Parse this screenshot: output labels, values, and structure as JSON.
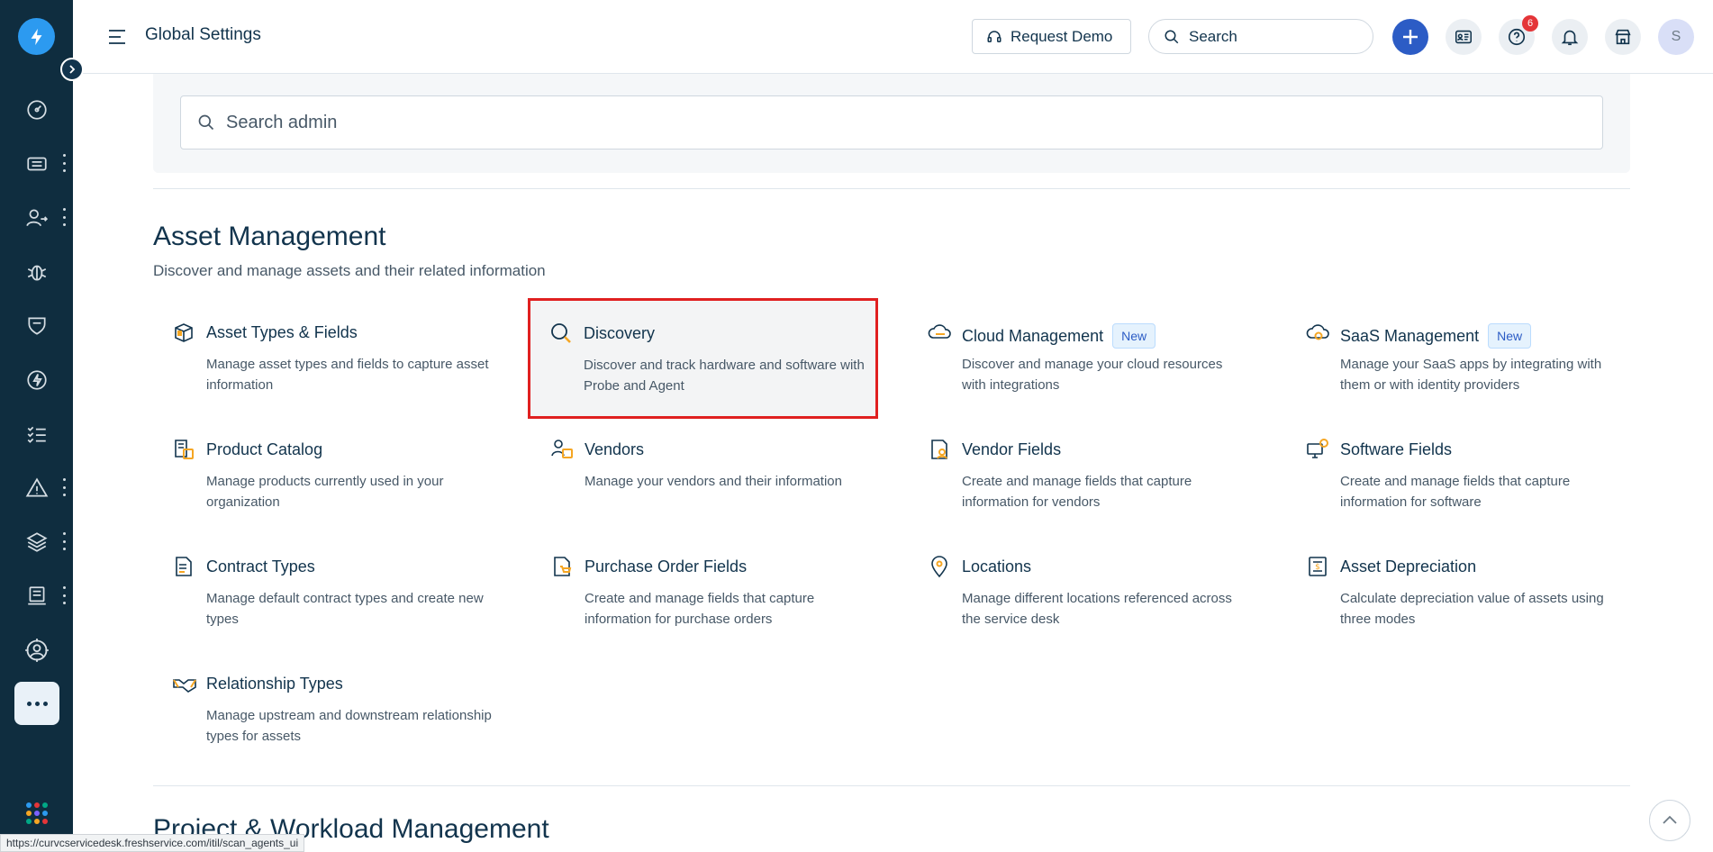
{
  "header": {
    "page_title": "Global Settings",
    "request_demo_label": "Request Demo",
    "search_placeholder": "Search",
    "help_badge_count": "6",
    "avatar_initial": "S"
  },
  "admin_search": {
    "placeholder": "Search admin"
  },
  "section": {
    "title": "Asset Management",
    "description": "Discover and manage assets and their related information"
  },
  "cards": [
    {
      "title": "Asset Types & Fields",
      "description": "Manage asset types and fields to capture asset information",
      "icon": "asset-types-icon"
    },
    {
      "title": "Discovery",
      "description": "Discover and track hardware and software with Probe and Agent",
      "icon": "discovery-icon"
    },
    {
      "title": "Cloud Management",
      "tag": "New",
      "description": "Discover and manage your cloud resources with integrations",
      "icon": "cloud-management-icon"
    },
    {
      "title": "SaaS Management",
      "tag": "New",
      "description": "Manage your SaaS apps by integrating with them or with identity providers",
      "icon": "saas-management-icon"
    },
    {
      "title": "Product Catalog",
      "description": "Manage products currently used in your organization",
      "icon": "product-catalog-icon"
    },
    {
      "title": "Vendors",
      "description": "Manage your vendors and their information",
      "icon": "vendors-icon"
    },
    {
      "title": "Vendor Fields",
      "description": "Create and manage fields that capture information for vendors",
      "icon": "vendor-fields-icon"
    },
    {
      "title": "Software Fields",
      "description": "Create and manage fields that capture information for software",
      "icon": "software-fields-icon"
    },
    {
      "title": "Contract Types",
      "description": "Manage default contract types and create new types",
      "icon": "contract-types-icon"
    },
    {
      "title": "Purchase Order Fields",
      "description": "Create and manage fields that capture information for purchase orders",
      "icon": "purchase-order-icon"
    },
    {
      "title": "Locations",
      "description": "Manage different locations referenced across the service desk",
      "icon": "location-pin-icon"
    },
    {
      "title": "Asset Depreciation",
      "description": "Calculate depreciation value of assets using three modes",
      "icon": "asset-depreciation-icon"
    },
    {
      "title": "Relationship Types",
      "description": "Manage upstream and downstream relationship types for assets",
      "icon": "relationship-types-icon"
    }
  ],
  "next_section_title": "Project & Workload Management",
  "status_bar_url": "https://curvcservicedesk.freshservice.com/itil/scan_agents_ui",
  "colors": {
    "rail": "#0f2d3f",
    "accent": "#2c5cc5",
    "highlight_border": "#e02020",
    "icon_accent": "#f5a623"
  }
}
